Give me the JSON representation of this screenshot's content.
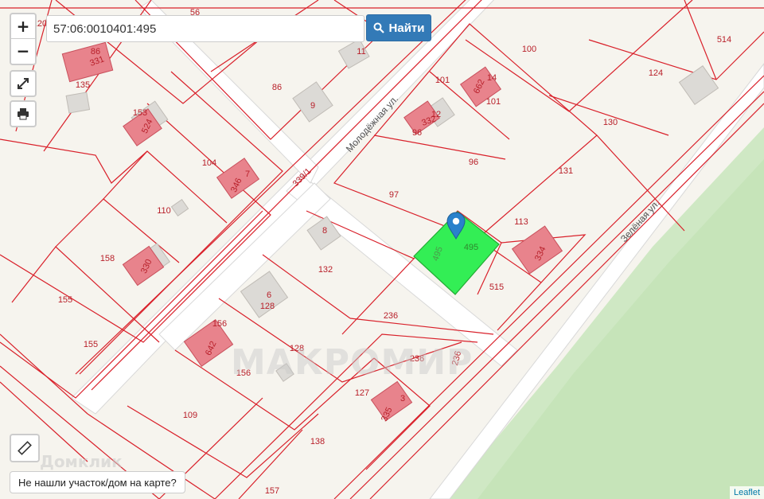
{
  "search": {
    "value": "57:06:0010401:495",
    "button_label": "Найти"
  },
  "controls": {
    "zoom_in": "+",
    "zoom_out": "−"
  },
  "not_found_label": "Не нашли участок/дом на карте?",
  "attribution": "Leaflet",
  "watermarks": {
    "center": "МАКРОМИР",
    "bottom": "Домклик"
  },
  "streets": [
    {
      "name": "Молодёжная ул."
    },
    {
      "name": "Зелёная ул."
    },
    {
      "name": "339/1"
    }
  ],
  "parcels": [
    "120",
    "86",
    "56",
    "135",
    "11",
    "86",
    "9",
    "101",
    "100",
    "124",
    "514",
    "153",
    "14",
    "101",
    "12",
    "96",
    "130",
    "104",
    "7",
    "96",
    "131",
    "97",
    "495",
    "495",
    "113",
    "110",
    "158",
    "8",
    "132",
    "155",
    "6",
    "128",
    "515",
    "155",
    "236",
    "156",
    "128",
    "236",
    "236",
    "156",
    "127",
    "3",
    "109",
    "138",
    "157"
  ],
  "houses": [
    "331",
    "524",
    "662",
    "332",
    "346",
    "334",
    "330",
    "642",
    "335"
  ],
  "selected_parcel": {
    "label": "495",
    "color": "#33ee55"
  },
  "colors": {
    "boundary": "#d9202a",
    "building": "#e8838c",
    "accent": "#337ab7"
  }
}
